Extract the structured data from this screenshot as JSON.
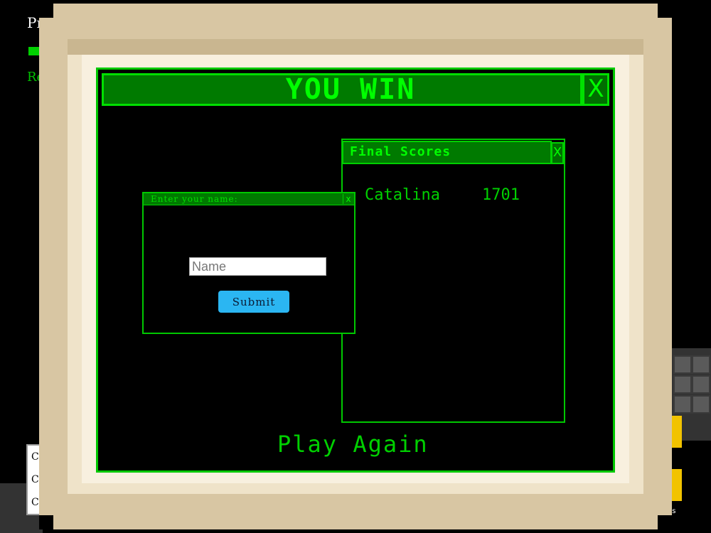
{
  "background": {
    "top_left_label": "Pr",
    "left_label": "Re",
    "box_items": [
      "C",
      "C",
      "C"
    ],
    "corner_label": "ions"
  },
  "dialog": {
    "title": "YOU WIN",
    "close_glyph": "X"
  },
  "scores_window": {
    "title": "Final Scores",
    "close_glyph": "X",
    "entries": [
      {
        "name": "Catalina",
        "score": "1701"
      }
    ]
  },
  "name_window": {
    "title": "Enter your name:",
    "close_glyph": "x",
    "input_placeholder": "Name",
    "input_value": "",
    "submit_label": "Submit"
  },
  "play_again_label": "Play Again",
  "colors": {
    "accent_green": "#00ff00",
    "bar_green": "#007a00",
    "submit_blue": "#2bb6f2",
    "frame_beige": "#d8c6a3"
  }
}
